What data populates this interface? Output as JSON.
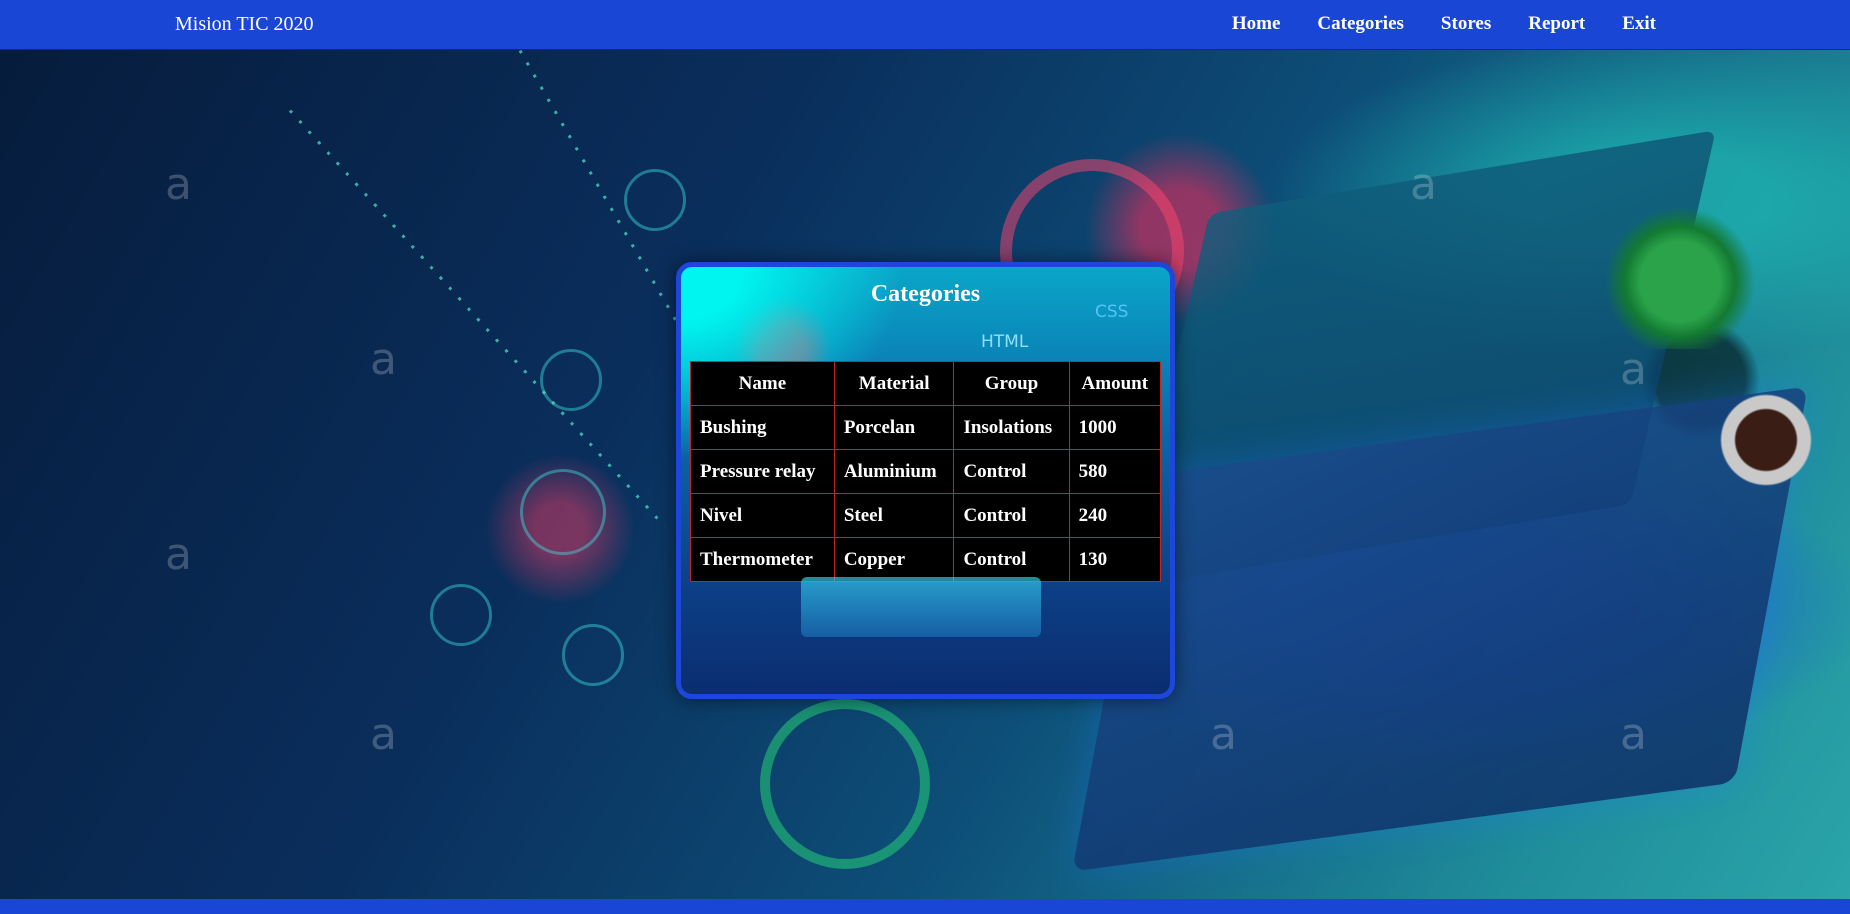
{
  "navbar": {
    "brand": "Mision TIC 2020",
    "links": [
      "Home",
      "Categories",
      "Stores",
      "Report",
      "Exit"
    ]
  },
  "card": {
    "title": "Categories",
    "headers": [
      "Name",
      "Material",
      "Group",
      "Amount"
    ],
    "rows": [
      [
        "Bushing",
        "Porcelan",
        "Insolations",
        "1000"
      ],
      [
        "Pressure relay",
        "Aluminium",
        "Control",
        "580"
      ],
      [
        "Nivel",
        "Steel",
        "Control",
        "240"
      ],
      [
        "Thermometer",
        "Copper",
        "Control",
        "130"
      ]
    ],
    "decor_html": "HTML",
    "decor_css": "CSS"
  },
  "colors": {
    "navbar": "#1a46d6",
    "table_border": "#c22525",
    "card_border": "#1c47d8"
  }
}
